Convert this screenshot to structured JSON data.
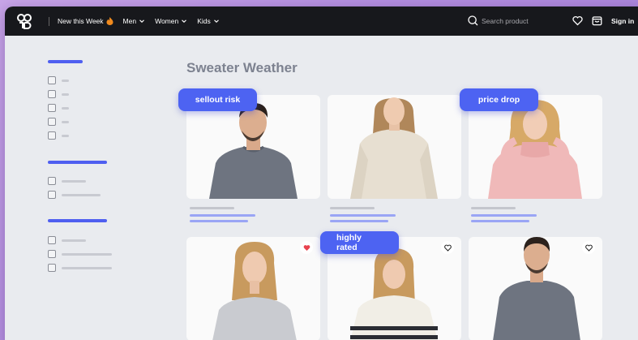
{
  "header": {
    "nav": [
      {
        "label": "New this Week",
        "has_fire": true
      },
      {
        "label": "Men",
        "has_chevron": true
      },
      {
        "label": "Women",
        "has_chevron": true
      },
      {
        "label": "Kids",
        "has_chevron": true
      }
    ],
    "search_placeholder": "Search product",
    "sign_in": "Sign in"
  },
  "page": {
    "title": "Sweater Weather"
  },
  "tags": {
    "sellout": "sellout risk",
    "price_drop": "price drop",
    "highly_rated": "highly rated"
  },
  "products": [
    {
      "id": "p1",
      "sweater_color": "#6e7480",
      "person": "man"
    },
    {
      "id": "p2",
      "sweater_color": "#e7dfd1",
      "person": "woman"
    },
    {
      "id": "p3",
      "sweater_color": "#f0b9b9",
      "person": "girl"
    },
    {
      "id": "p4",
      "sweater_color": "#c9cbd0",
      "person": "woman",
      "liked": true
    },
    {
      "id": "p5",
      "sweater_color": "#f1eee6",
      "person": "woman-striped"
    },
    {
      "id": "p6",
      "sweater_color": "#6e7480",
      "person": "man"
    }
  ],
  "colors": {
    "accent": "#4d63f2",
    "topbar": "#17181c",
    "like": "#e8434f"
  }
}
